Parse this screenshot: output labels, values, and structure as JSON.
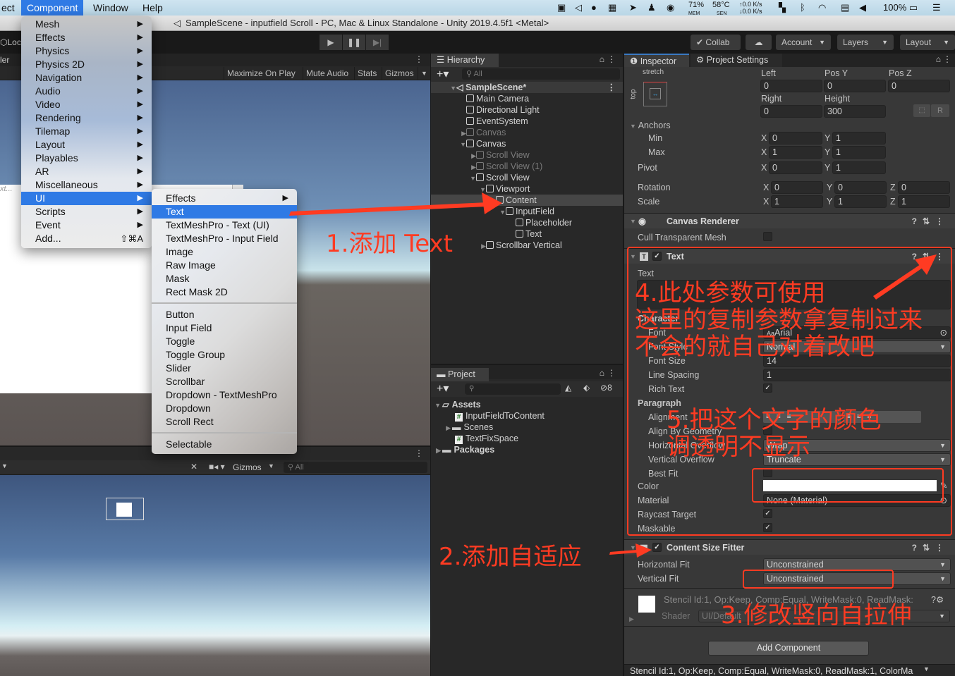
{
  "menubar": {
    "items": [
      "ect",
      "Component",
      "Window",
      "Help"
    ],
    "active": "Component",
    "tray": {
      "mem": "71%",
      "mem_label": "MEM",
      "temp": "58°C",
      "temp_label": "SEN",
      "net_up": "0.0 K/s",
      "net_down": "0.0 K/s",
      "battery": "100%"
    }
  },
  "window_title": "SampleScene - inputfield Scroll - PC, Mac & Linux Standalone - Unity 2019.4.5f1 <Metal>",
  "toolbar": {
    "left_label": "Loc",
    "collab": "Collab",
    "account": "Account",
    "layers": "Layers",
    "layout": "Layout"
  },
  "game_panel": {
    "tab_partial": "ler",
    "options": [
      "Maximize On Play",
      "Mute Audio",
      "Stats",
      "Gizmos"
    ],
    "placeholder_partial": "xt..."
  },
  "scene_panel": {
    "gizmos": "Gizmos",
    "search_placeholder": "All"
  },
  "component_menu": {
    "items": [
      {
        "label": "Mesh",
        "submenu": true
      },
      {
        "label": "Effects",
        "submenu": true
      },
      {
        "label": "Physics",
        "submenu": true
      },
      {
        "label": "Physics 2D",
        "submenu": true
      },
      {
        "label": "Navigation",
        "submenu": true
      },
      {
        "label": "Audio",
        "submenu": true
      },
      {
        "label": "Video",
        "submenu": true
      },
      {
        "label": "Rendering",
        "submenu": true
      },
      {
        "label": "Tilemap",
        "submenu": true
      },
      {
        "label": "Layout",
        "submenu": true
      },
      {
        "label": "Playables",
        "submenu": true
      },
      {
        "label": "AR",
        "submenu": true
      },
      {
        "label": "Miscellaneous",
        "submenu": true
      },
      {
        "label": "UI",
        "submenu": true,
        "selected": true
      },
      {
        "label": "Scripts",
        "submenu": true
      },
      {
        "label": "Event",
        "submenu": true
      },
      {
        "label": "Add...",
        "shortcut": "⇧⌘A"
      }
    ]
  },
  "ui_submenu": {
    "group1": [
      "Effects",
      "Text",
      "TextMeshPro - Text (UI)",
      "TextMeshPro - Input Field",
      "Image",
      "Raw Image",
      "Mask",
      "Rect Mask 2D"
    ],
    "group2": [
      "Button",
      "Input Field",
      "Toggle",
      "Toggle Group",
      "Slider",
      "Scrollbar",
      "Dropdown - TextMeshPro",
      "Dropdown",
      "Scroll Rect"
    ],
    "group3": [
      "Selectable"
    ],
    "selected": "Text"
  },
  "hierarchy": {
    "tab": "Hierarchy",
    "search_placeholder": "All",
    "items": [
      {
        "label": "SampleScene*",
        "depth": 0,
        "expanded": true,
        "scene": true
      },
      {
        "label": "Main Camera",
        "depth": 1
      },
      {
        "label": "Directional Light",
        "depth": 1
      },
      {
        "label": "EventSystem",
        "depth": 1
      },
      {
        "label": "Canvas",
        "depth": 1,
        "collapsed": true,
        "dim": true
      },
      {
        "label": "Canvas",
        "depth": 1,
        "expanded": true
      },
      {
        "label": "Scroll View",
        "depth": 2,
        "collapsed": true,
        "dim": true
      },
      {
        "label": "Scroll View (1)",
        "depth": 2,
        "collapsed": true,
        "dim": true
      },
      {
        "label": "Scroll View",
        "depth": 2,
        "expanded": true
      },
      {
        "label": "Viewport",
        "depth": 3,
        "expanded": true
      },
      {
        "label": "Content",
        "depth": 4,
        "expanded": true,
        "selected": true
      },
      {
        "label": "InputField",
        "depth": 5,
        "expanded": true
      },
      {
        "label": "Placeholder",
        "depth": 6
      },
      {
        "label": "Text",
        "depth": 6
      },
      {
        "label": "Scrollbar Vertical",
        "depth": 3,
        "collapsed": true
      }
    ]
  },
  "project": {
    "tab": "Project",
    "hidden_count": "8",
    "items": [
      {
        "label": "Assets",
        "type": "folder-open",
        "depth": 0,
        "expanded": true
      },
      {
        "label": "InputFieldToContent",
        "type": "script",
        "depth": 1
      },
      {
        "label": "Scenes",
        "type": "folder",
        "depth": 1,
        "collapsed": true
      },
      {
        "label": "TextFixSpace",
        "type": "script",
        "depth": 1
      },
      {
        "label": "Packages",
        "type": "folder",
        "depth": 0,
        "collapsed": true
      }
    ]
  },
  "inspector": {
    "tabs": [
      "Inspector",
      "Project Settings"
    ],
    "rect_transform": {
      "anchor_preset_h": "stretch",
      "anchor_preset_v": "top",
      "labels": {
        "left": "Left",
        "posy": "Pos Y",
        "posz": "Pos Z",
        "right": "Right",
        "height": "Height"
      },
      "left": "0",
      "pos_y": "0",
      "pos_z": "0",
      "right": "0",
      "height": "300",
      "raw_btn": "R",
      "anchors_label": "Anchors",
      "min_label": "Min",
      "min_x": "0",
      "min_y": "1",
      "max_label": "Max",
      "max_x": "1",
      "max_y": "1",
      "pivot_label": "Pivot",
      "pivot_x": "0",
      "pivot_y": "1",
      "rotation_label": "Rotation",
      "rot_x": "0",
      "rot_y": "0",
      "rot_z": "0",
      "scale_label": "Scale",
      "scale_x": "1",
      "scale_y": "1",
      "scale_z": "1"
    },
    "canvas_renderer": {
      "title": "Canvas Renderer",
      "cull_label": "Cull Transparent Mesh",
      "cull": false
    },
    "text": {
      "title": "Text",
      "enabled": true,
      "text_label": "Text",
      "text_value": "",
      "character_label": "Character",
      "font_label": "Font",
      "font": "Arial",
      "font_style_label": "Font Style",
      "font_style": "Normal",
      "font_size_label": "Font Size",
      "font_size": "14",
      "line_spacing_label": "Line Spacing",
      "line_spacing": "1",
      "rich_text_label": "Rich Text",
      "rich_text": true,
      "paragraph_label": "Paragraph",
      "alignment_label": "Alignment",
      "align_geom_label": "Align By Geometry",
      "align_geom": false,
      "h_overflow_label": "Horizontal Overflow",
      "h_overflow": "Wrap",
      "v_overflow_label": "Vertical Overflow",
      "v_overflow": "Truncate",
      "best_fit_label": "Best Fit",
      "best_fit": false,
      "color_label": "Color",
      "color": "#ffffff",
      "material_label": "Material",
      "material": "None (Material)",
      "raycast_label": "Raycast Target",
      "raycast": true,
      "maskable_label": "Maskable",
      "maskable": true
    },
    "content_size_fitter": {
      "title": "Content Size Fitter",
      "enabled": true,
      "h_fit_label": "Horizontal Fit",
      "h_fit": "Unconstrained",
      "v_fit_label": "Vertical Fit",
      "v_fit": "Unconstrained"
    },
    "material_preview": {
      "stencil": "Stencil Id:1, Op:Keep, Comp:Equal, WriteMask:0, ReadMask:",
      "shader_label": "Shader",
      "shader": "UI/Default"
    },
    "add_component": "Add Component",
    "footer": "Stencil Id:1, Op:Keep, Comp:Equal, WriteMask:0, ReadMask:1, ColorMa"
  },
  "annotations": {
    "step1": "1.添加 Text",
    "step2": "2.添加自适应",
    "step3": "3.修改竖向自拉伸",
    "step4_line1": "4.此处参数可使用",
    "step4_line2": "这里的复制参数拿复制过来",
    "step4_line3": "不会的就自己对着改吧",
    "step5_line1": "5.把这个文字的颜色",
    "step5_line2": "调透明不显示",
    "color": "#ff3b22"
  }
}
